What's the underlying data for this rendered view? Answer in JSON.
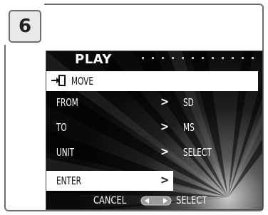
{
  "step": {
    "number": "6"
  },
  "screen": {
    "title": "PLAY",
    "menu": [
      {
        "label": "MOVE",
        "icon": "move-icon",
        "highlighted": true
      },
      {
        "label": "FROM",
        "arrow": ">",
        "value": "SD"
      },
      {
        "label": "TO",
        "arrow": ">",
        "value": "MS"
      },
      {
        "label": "UNIT",
        "arrow": ">",
        "value": "SELECT"
      },
      {
        "label": "ENTER",
        "arrow": ">",
        "highlighted": true
      }
    ],
    "bottom": {
      "cancel": "CANCEL",
      "select": "SELECT"
    }
  },
  "colors": {
    "highlight": "#ffffff",
    "screen_bg": "#0d0d0d",
    "text": "#ffffff"
  }
}
